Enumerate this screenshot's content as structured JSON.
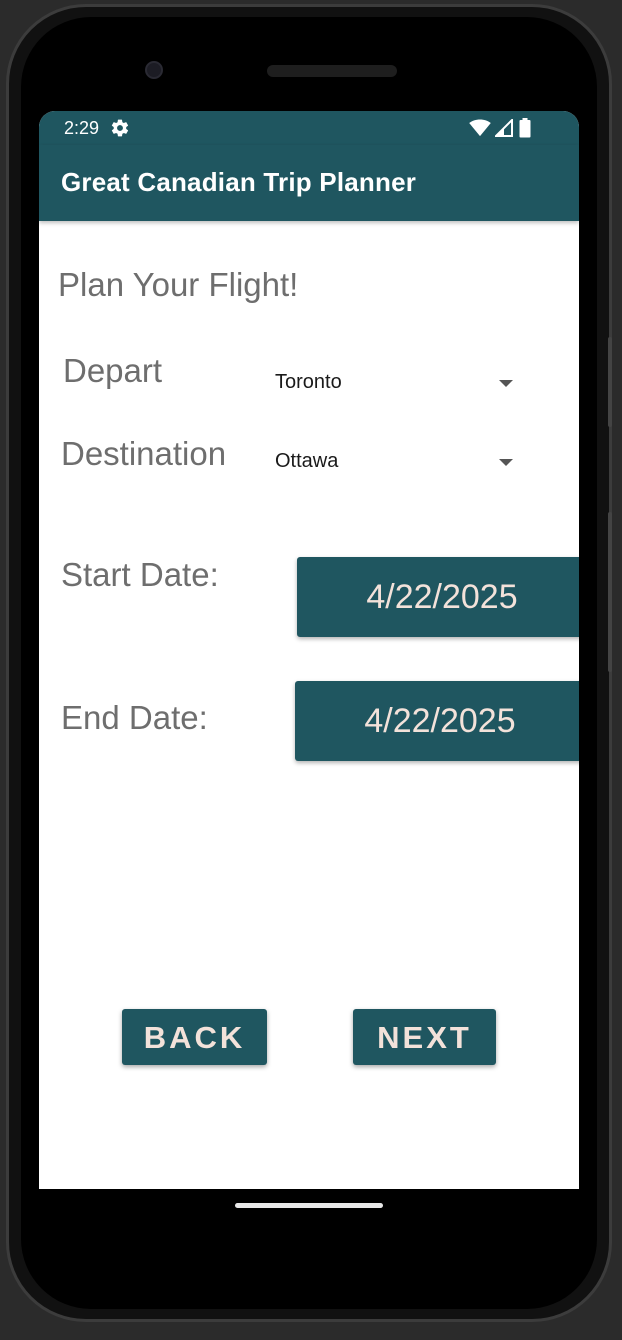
{
  "status_bar": {
    "time": "2:29",
    "icons": [
      "gear-icon",
      "wifi-icon",
      "cell-signal-icon",
      "battery-icon"
    ]
  },
  "app_bar": {
    "title": "Great Canadian Trip Planner"
  },
  "form": {
    "heading": "Plan Your Flight!",
    "depart": {
      "label": "Depart",
      "value": "Toronto"
    },
    "destination": {
      "label": "Destination",
      "value": "Ottawa"
    },
    "start_date": {
      "label": "Start Date:",
      "value": "4/22/2025"
    },
    "end_date": {
      "label": "End Date:",
      "value": "4/22/2025"
    }
  },
  "actions": {
    "back_label": "BACK",
    "next_label": "NEXT"
  },
  "colors": {
    "primary": "#1f5660",
    "button_text": "#f3e2da",
    "label_text": "#6e6e6e"
  }
}
